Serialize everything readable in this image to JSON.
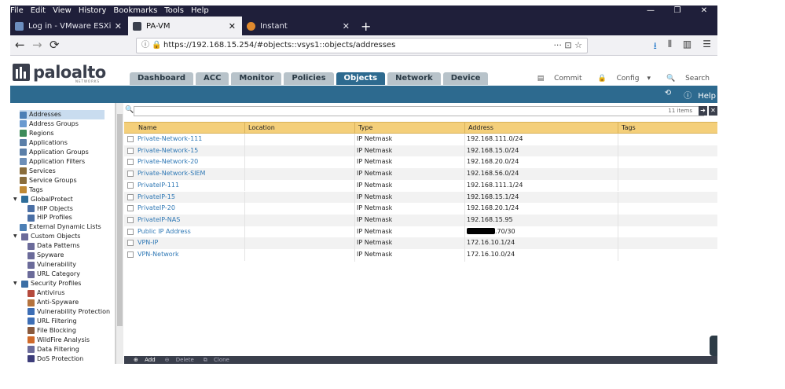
{
  "menubar": [
    "File",
    "Edit",
    "View",
    "History",
    "Bookmarks",
    "Tools",
    "Help"
  ],
  "window_controls": [
    "—",
    "❐",
    "✕"
  ],
  "tabs": [
    {
      "label": "Log in - VMware ESXi"
    },
    {
      "label": "PA-VM"
    },
    {
      "label": "Instant"
    }
  ],
  "url": "https://192.168.15.254/#objects::vsys1::objects/addresses",
  "brand": {
    "name": "paloalto",
    "sub": "NETWORKS"
  },
  "main_tabs": [
    "Dashboard",
    "ACC",
    "Monitor",
    "Policies",
    "Objects",
    "Network",
    "Device"
  ],
  "active_main_tab": "Objects",
  "header_actions": {
    "commit": "Commit",
    "config": "Config",
    "search": "Search"
  },
  "band_actions": {
    "help": "Help"
  },
  "sidebar": [
    {
      "label": "Addresses",
      "level": 0,
      "selected": true
    },
    {
      "label": "Address Groups",
      "level": 0
    },
    {
      "label": "Regions",
      "level": 0
    },
    {
      "label": "Applications",
      "level": 0
    },
    {
      "label": "Application Groups",
      "level": 0
    },
    {
      "label": "Application Filters",
      "level": 0
    },
    {
      "label": "Services",
      "level": 0
    },
    {
      "label": "Service Groups",
      "level": 0
    },
    {
      "label": "Tags",
      "level": 0
    },
    {
      "label": "GlobalProtect",
      "level": 0,
      "expanded": true
    },
    {
      "label": "HIP Objects",
      "level": 1
    },
    {
      "label": "HIP Profiles",
      "level": 1
    },
    {
      "label": "External Dynamic Lists",
      "level": 0
    },
    {
      "label": "Custom Objects",
      "level": 0,
      "expanded": true
    },
    {
      "label": "Data Patterns",
      "level": 1
    },
    {
      "label": "Spyware",
      "level": 1
    },
    {
      "label": "Vulnerability",
      "level": 1
    },
    {
      "label": "URL Category",
      "level": 1
    },
    {
      "label": "Security Profiles",
      "level": 0,
      "expanded": true
    },
    {
      "label": "Antivirus",
      "level": 1
    },
    {
      "label": "Anti-Spyware",
      "level": 1
    },
    {
      "label": "Vulnerability Protection",
      "level": 1
    },
    {
      "label": "URL Filtering",
      "level": 1
    },
    {
      "label": "File Blocking",
      "level": 1
    },
    {
      "label": "WildFire Analysis",
      "level": 1
    },
    {
      "label": "Data Filtering",
      "level": 1
    },
    {
      "label": "DoS Protection",
      "level": 1
    }
  ],
  "filter": {
    "count": "11 items"
  },
  "columns": [
    "Name",
    "Location",
    "Type",
    "Address",
    "Tags"
  ],
  "rows": [
    {
      "name": "Private-Network-111",
      "location": "",
      "type": "IP Netmask",
      "address": "192.168.111.0/24",
      "tags": ""
    },
    {
      "name": "Private-Network-15",
      "location": "",
      "type": "IP Netmask",
      "address": "192.168.15.0/24",
      "tags": ""
    },
    {
      "name": "Private-Network-20",
      "location": "",
      "type": "IP Netmask",
      "address": "192.168.20.0/24",
      "tags": ""
    },
    {
      "name": "Private-Network-SIEM",
      "location": "",
      "type": "IP Netmask",
      "address": "192.168.56.0/24",
      "tags": ""
    },
    {
      "name": "PrivateIP-111",
      "location": "",
      "type": "IP Netmask",
      "address": "192.168.111.1/24",
      "tags": ""
    },
    {
      "name": "PrivateIP-15",
      "location": "",
      "type": "IP Netmask",
      "address": "192.168.15.1/24",
      "tags": ""
    },
    {
      "name": "PrivateIP-20",
      "location": "",
      "type": "IP Netmask",
      "address": "192.168.20.1/24",
      "tags": ""
    },
    {
      "name": "PrivateIP-NAS",
      "location": "",
      "type": "IP Netmask",
      "address": "192.168.15.95",
      "tags": ""
    },
    {
      "name": "Public IP Address",
      "location": "",
      "type": "IP Netmask",
      "address": ".70/30",
      "tags": "",
      "redacted": true
    },
    {
      "name": "VPN-IP",
      "location": "",
      "type": "IP Netmask",
      "address": "172.16.10.1/24",
      "tags": ""
    },
    {
      "name": "VPN-Network",
      "location": "",
      "type": "IP Netmask",
      "address": "172.16.10.0/24",
      "tags": ""
    }
  ],
  "bottom_actions": {
    "add": "Add",
    "delete": "Delete",
    "clone": "Clone"
  },
  "colors": {
    "accent_blue": "#2d6a8f",
    "header_yellow": "#f4cf7a",
    "link_blue": "#2f78b5",
    "browser_dark": "#1f1f3a"
  }
}
